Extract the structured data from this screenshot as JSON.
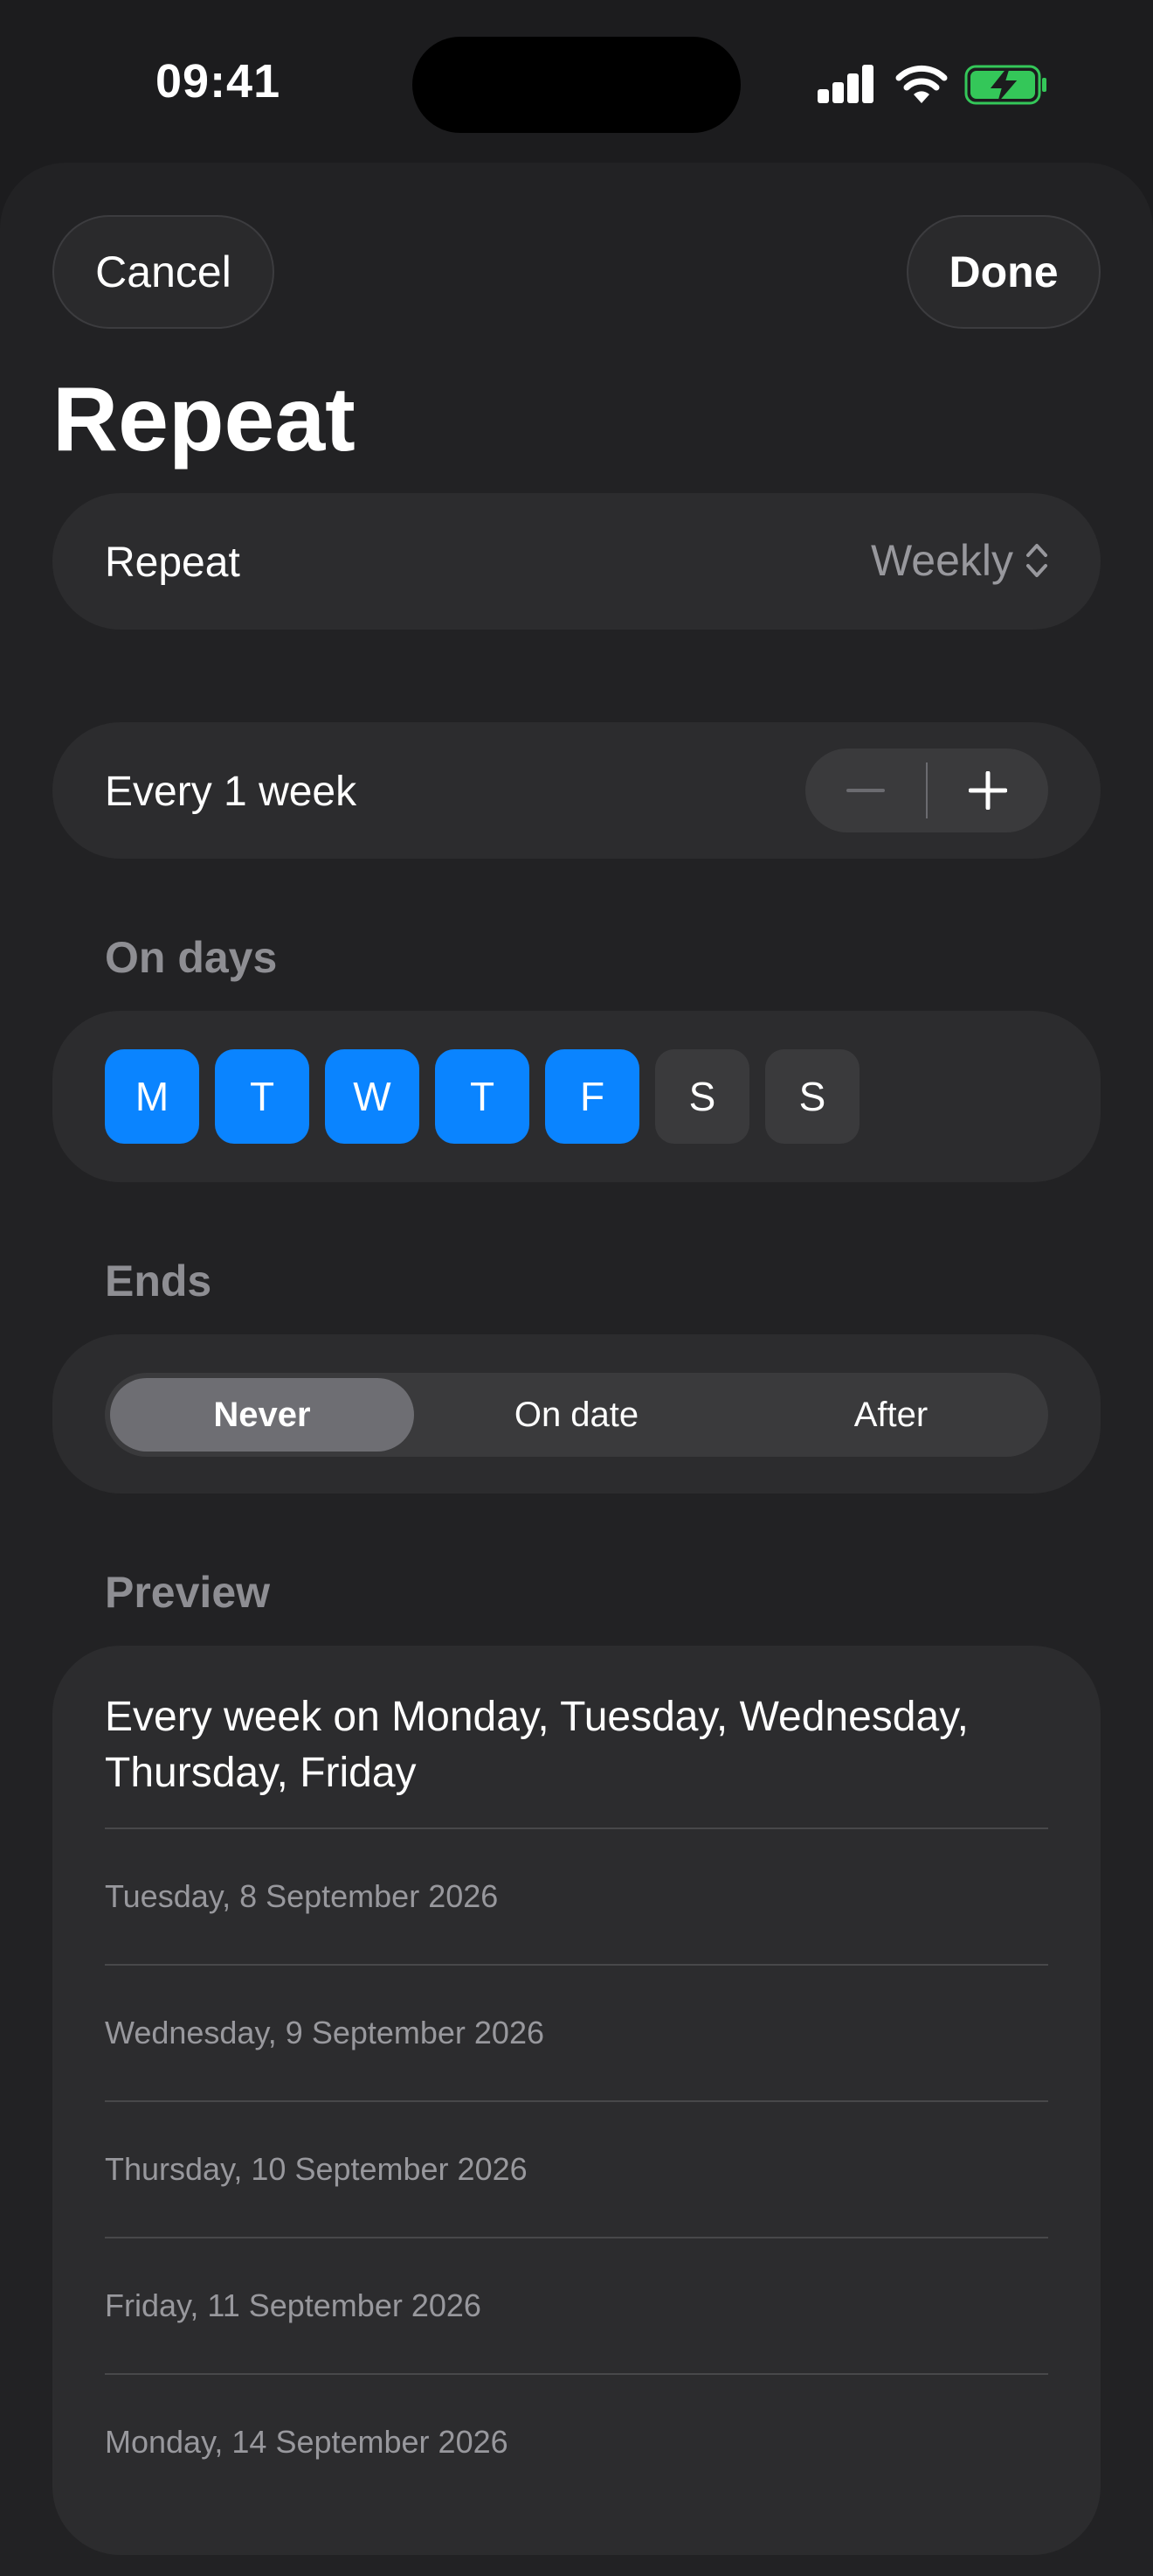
{
  "status_bar": {
    "time": "09:41"
  },
  "nav": {
    "cancel_label": "Cancel",
    "done_label": "Done",
    "title": "Repeat"
  },
  "repeat_row": {
    "label": "Repeat",
    "value": "Weekly",
    "icon": "chevron-up-down-icon"
  },
  "interval_row": {
    "label": "Every 1 week",
    "minus_icon": "minus-icon",
    "plus_icon": "plus-icon"
  },
  "on_days": {
    "header": "On days",
    "days": [
      {
        "label": "M",
        "selected": true
      },
      {
        "label": "T",
        "selected": true
      },
      {
        "label": "W",
        "selected": true
      },
      {
        "label": "T",
        "selected": true
      },
      {
        "label": "F",
        "selected": true
      },
      {
        "label": "S",
        "selected": false
      },
      {
        "label": "S",
        "selected": false
      }
    ]
  },
  "ends": {
    "header": "Ends",
    "options": [
      "Never",
      "On date",
      "After"
    ],
    "selected": "Never"
  },
  "preview": {
    "header": "Preview",
    "summary": "Every week on Monday, Tuesday, Wednesday, Thursday, Friday",
    "dates": [
      "Tuesday, 8 September 2026",
      "Wednesday, 9 September 2026",
      "Thursday, 10 September 2026",
      "Friday, 11 September 2026",
      "Monday, 14 September 2026"
    ]
  },
  "colors": {
    "accent": "#0a84ff",
    "background": "#1c1c1e",
    "sheet": "#222224",
    "card": "#2c2c2e",
    "secondary_text": "#98989d",
    "battery": "#34c759"
  }
}
